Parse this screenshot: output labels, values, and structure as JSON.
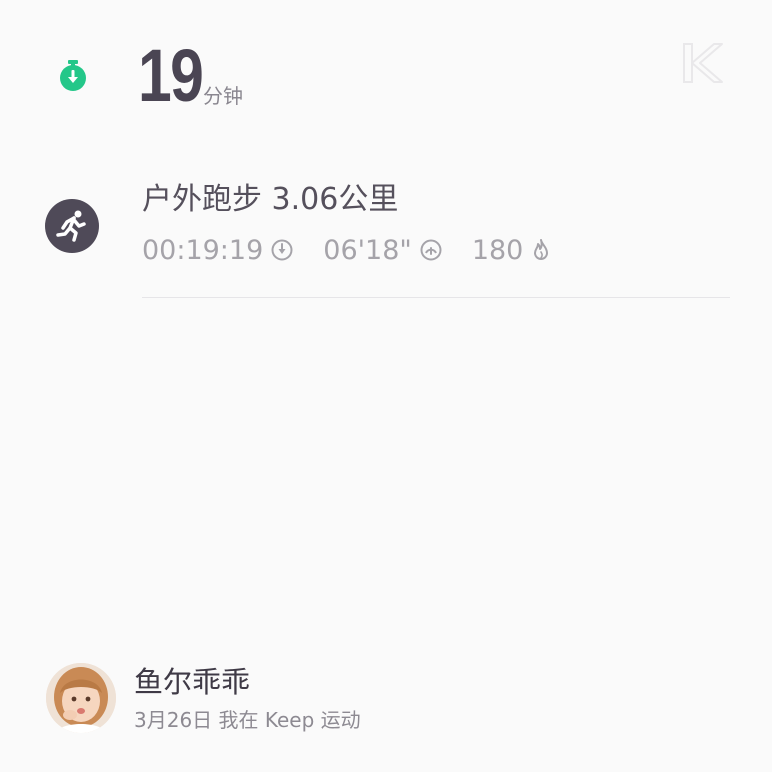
{
  "summary": {
    "minutes": "19",
    "unit": "分钟"
  },
  "icons": {
    "timer": "stopwatch-icon",
    "activity": "running-icon",
    "duration": "clock-icon",
    "pace": "speedometer-icon",
    "calories": "flame-icon",
    "brand": "keep-k-icon"
  },
  "activity": {
    "title": "户外跑步 3.06公里",
    "duration": "00:19:19",
    "pace": "06'18\"",
    "calories": "180"
  },
  "user": {
    "name": "鱼尔乖乖",
    "subtitle": "3月26日 我在 Keep 运动"
  },
  "colors": {
    "accent": "#24c789",
    "icon_dark": "#4f4a58",
    "text_dark": "#4a4553",
    "text_muted": "#a5a3a9"
  }
}
